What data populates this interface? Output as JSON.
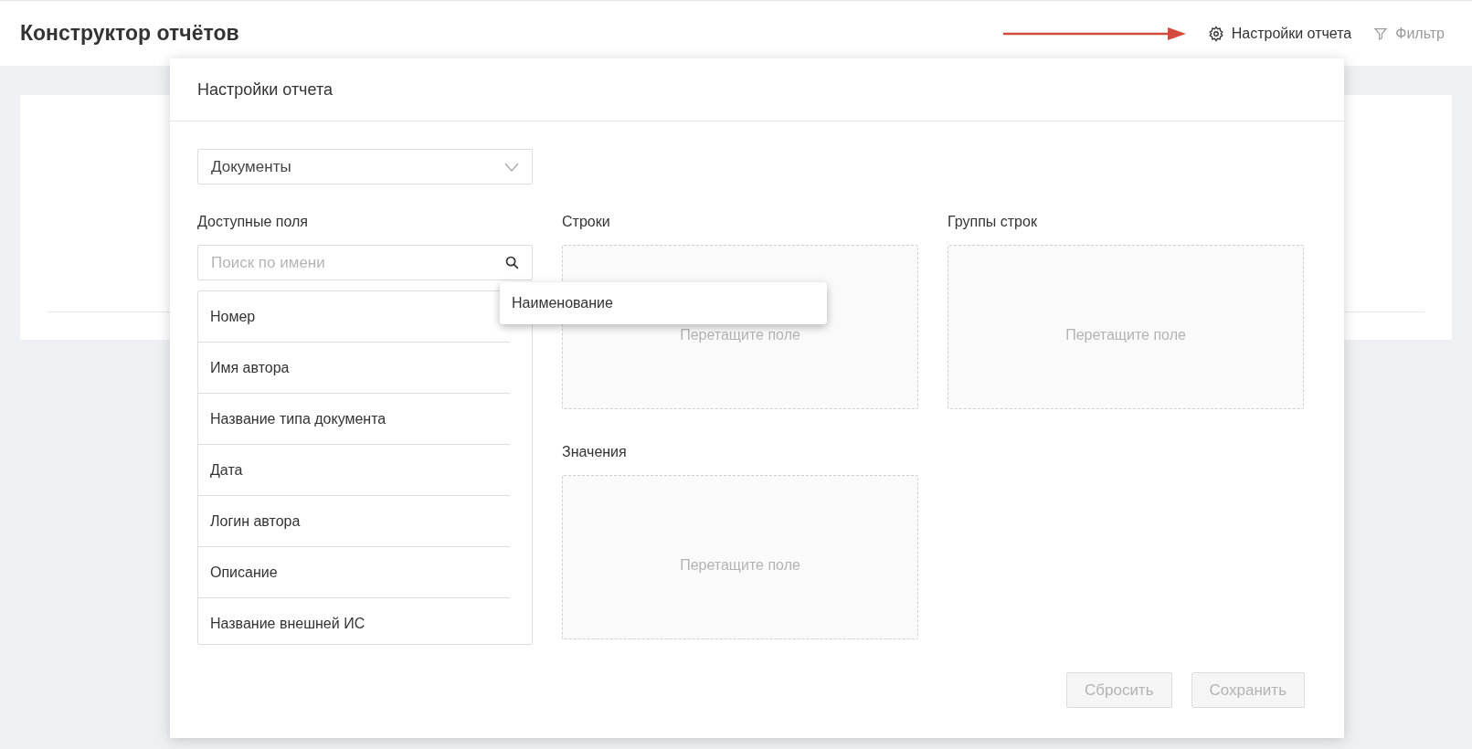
{
  "page": {
    "title": "Конструктор отчётов"
  },
  "toolbar": [
    {
      "kind": "settings",
      "label": "Настройки отчета",
      "disabled": false
    },
    {
      "kind": "filter",
      "label": "Фильтр",
      "disabled": true
    }
  ],
  "dialog": {
    "title": "Настройки отчета",
    "source": {
      "value": "Документы"
    },
    "available": {
      "label": "Доступные поля",
      "search": {
        "placeholder": "Поиск по имени"
      },
      "fields": [
        "Номер",
        "Имя автора",
        "Название типа документа",
        "Дата",
        "Логин автора",
        "Описание",
        "Название внешней ИС"
      ]
    },
    "zones": [
      {
        "label": "Строки",
        "placeholder": "Перетащите поле"
      },
      {
        "label": "Группы строк",
        "placeholder": "Перетащите поле"
      },
      {
        "label": "Значения",
        "placeholder": "Перетащите поле"
      }
    ],
    "dragging": {
      "label": "Наименование"
    },
    "buttons": [
      {
        "label": "Сбросить",
        "disabled": true
      },
      {
        "label": "Сохранить",
        "disabled": true
      }
    ]
  }
}
